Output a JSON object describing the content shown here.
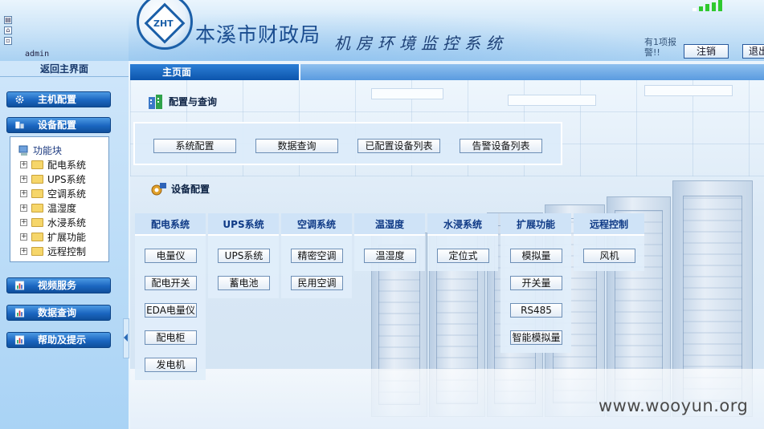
{
  "header": {
    "logo_text": "ZHT",
    "org_name": "本溪市财政局",
    "system_title": "机房环境监控系统",
    "user": "admin",
    "notice": "有1项报警!!",
    "logout_label": "注销",
    "exit_label": "退出"
  },
  "sidebar": {
    "back_main": "返回主界面",
    "menu": [
      {
        "label": "主机配置",
        "icon": "gear-icon"
      },
      {
        "label": "设备配置",
        "icon": "device-icon"
      },
      {
        "label": "视频服务",
        "icon": "chart-icon"
      },
      {
        "label": "数据查询",
        "icon": "chart-icon"
      },
      {
        "label": "帮助及提示",
        "icon": "chart-icon"
      }
    ],
    "tree": {
      "root": "功能块",
      "items": [
        "配电系统",
        "UPS系统",
        "空调系统",
        "温湿度",
        "水浸系统",
        "扩展功能",
        "远程控制"
      ]
    }
  },
  "main": {
    "tab": "主页面",
    "config_title": "配置与查询",
    "config_buttons": [
      "系统配置",
      "数据查询",
      "已配置设备列表",
      "告警设备列表"
    ],
    "device_title": "设备配置",
    "columns": [
      {
        "title": "配电系统",
        "items": [
          "电量仪",
          "配电开关",
          "EDA电量仪",
          "配电柜",
          "发电机"
        ]
      },
      {
        "title": "UPS系统",
        "items": [
          "UPS系统",
          "蓄电池"
        ]
      },
      {
        "title": "空调系统",
        "items": [
          "精密空调",
          "民用空调"
        ]
      },
      {
        "title": "温湿度",
        "items": [
          "温湿度"
        ]
      },
      {
        "title": "水浸系统",
        "items": [
          "定位式"
        ]
      },
      {
        "title": "扩展功能",
        "items": [
          "模拟量",
          "开关量",
          "RS485",
          "智能模拟量"
        ]
      },
      {
        "title": "远程控制",
        "items": [
          "风机"
        ]
      }
    ]
  },
  "watermark": "www.wooyun.org",
  "colors": {
    "accent": "#1b66c0",
    "header_bg": "#cfe6f8",
    "signal": "#2fc92f"
  }
}
